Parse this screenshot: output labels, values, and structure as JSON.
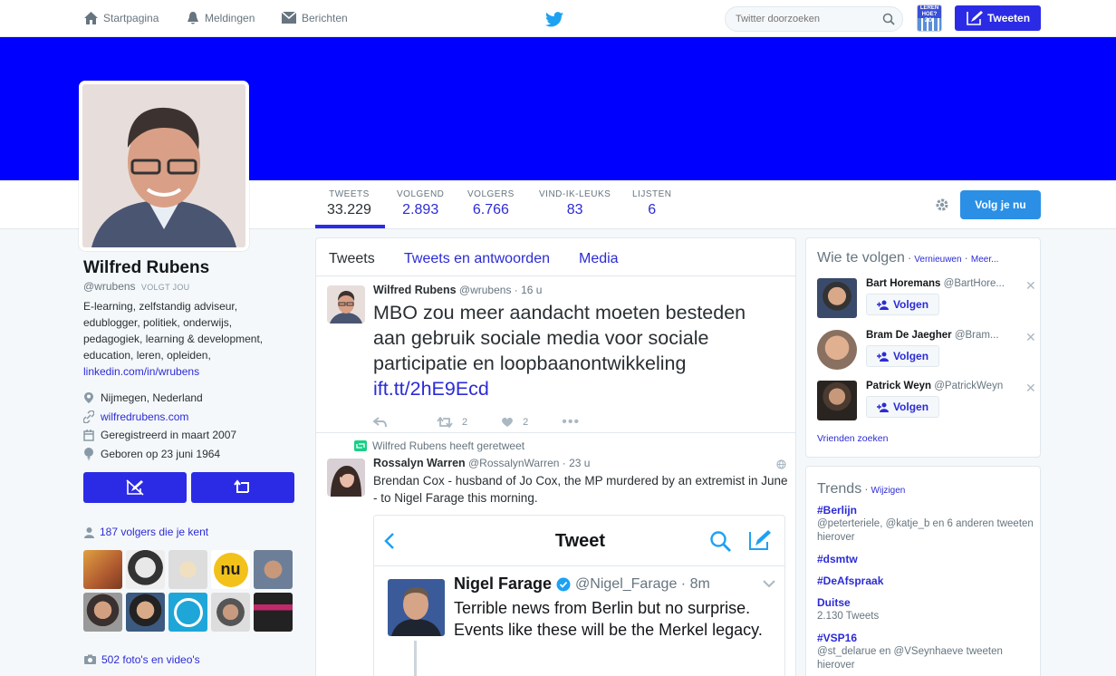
{
  "nav": {
    "home": "Startpagina",
    "notifications": "Meldingen",
    "messages": "Berichten",
    "search_placeholder": "Twitter doorzoeken",
    "tweet_button": "Tweeten",
    "mini_avatar_text": "LEREN HOE?ZO!"
  },
  "stats": [
    {
      "label": "TWEETS",
      "value": "33.229"
    },
    {
      "label": "VOLGEND",
      "value": "2.893"
    },
    {
      "label": "VOLGERS",
      "value": "6.766"
    },
    {
      "label": "VIND-IK-LEUKS",
      "value": "83"
    },
    {
      "label": "LIJSTEN",
      "value": "6"
    }
  ],
  "follow_button": "Volg je nu",
  "profile": {
    "name": "Wilfred Rubens",
    "handle": "@wrubens",
    "follows_you": "VOLGT JOU",
    "bio": [
      "E-learning, zelfstandig adviseur,",
      "edublogger, politiek, onderwijs,",
      "pedagogiek, learning & development,",
      "education, leren, opleiden,"
    ],
    "bio_link": "linkedin.com/in/wrubens",
    "location": "Nijmegen, Nederland",
    "website": "wilfredrubens.com",
    "joined": "Geregistreerd in maart 2007",
    "birthday": "Geboren op 23 juni 1964",
    "known_followers": "187 volgers die je kent",
    "photos": "502 foto's en video's"
  },
  "tabs": [
    "Tweets",
    "Tweets en antwoorden",
    "Media"
  ],
  "tweets": [
    {
      "name": "Wilfred Rubens",
      "handle": "@wrubens",
      "time": "16 u",
      "text": "MBO zou meer aandacht moeten besteden aan gebruik sociale media voor sociale participatie en loopbaanontwikkeling",
      "link": "ift.tt/2hE9Ecd",
      "retweets": "2",
      "likes": "2"
    },
    {
      "retweet_note": "Wilfred Rubens heeft geretweet",
      "name": "Rossalyn Warren",
      "handle": "@RossalynWarren",
      "time": "23 u",
      "text": "Brendan Cox - husband of Jo Cox, the MP murdered by an extremist in June - to Nigel Farage this morning."
    }
  ],
  "embed": {
    "header": "Tweet",
    "name": "Nigel Farage",
    "handle": "@Nigel_Farage",
    "time": "8m",
    "text": "Terrible news from Berlin but no surprise. Events like these will be the Merkel legacy."
  },
  "wtf": {
    "title": "Wie te volgen",
    "refresh": "Vernieuwen",
    "more": "Meer...",
    "follow_label": "Volgen",
    "find_friends": "Vrienden zoeken",
    "suggestions": [
      {
        "name": "Bart Horemans",
        "handle": "@BartHore..."
      },
      {
        "name": "Bram De Jaegher",
        "handle": "@Bram..."
      },
      {
        "name": "Patrick Weyn",
        "handle": "@PatrickWeyn"
      }
    ]
  },
  "trends": {
    "title": "Trends",
    "change": "Wijzigen",
    "items": [
      {
        "name": "#Berlijn",
        "desc": "@peterteriele, @katje_b en 6 anderen tweeten hierover"
      },
      {
        "name": "#dsmtw",
        "desc": ""
      },
      {
        "name": "#DeAfspraak",
        "desc": ""
      },
      {
        "name": "Duitse",
        "desc": "2.130 Tweets"
      },
      {
        "name": "#VSP16",
        "desc": "@st_delarue en @VSeynhaeve tweeten hierover"
      }
    ]
  }
}
